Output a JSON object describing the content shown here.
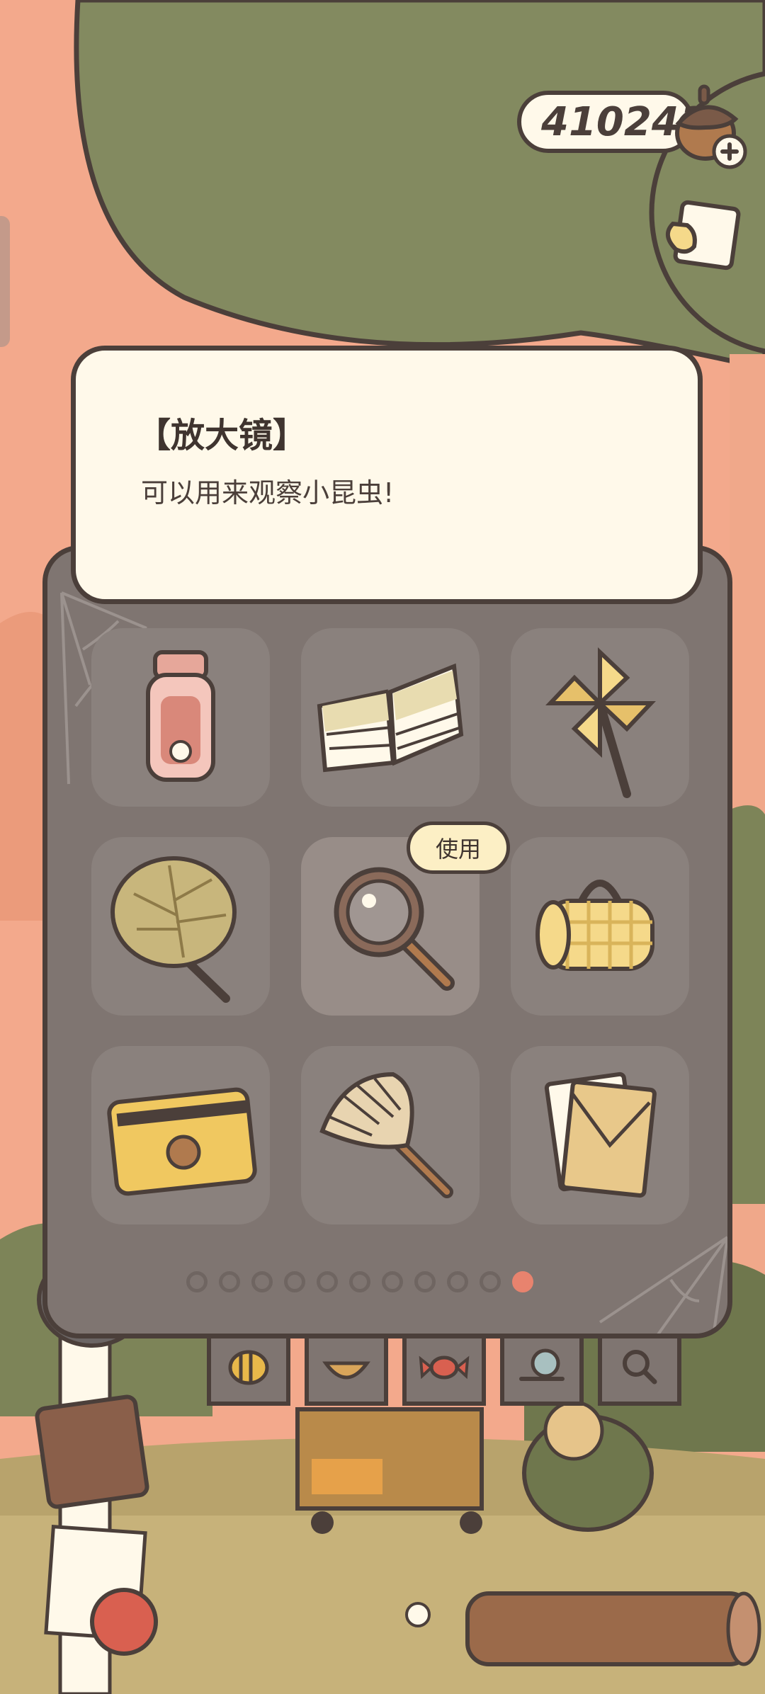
{
  "currency": {
    "amount": "410243",
    "icon": "acorn-icon",
    "plus_icon": "plus-icon"
  },
  "item_detail": {
    "title": "【放大镜】",
    "description": "可以用来观察小昆虫!"
  },
  "inventory": {
    "items": [
      {
        "icon": "jar-icon"
      },
      {
        "icon": "book-icon"
      },
      {
        "icon": "pinwheel-icon"
      },
      {
        "icon": "leaf-fan-icon"
      },
      {
        "icon": "magnifying-glass-icon",
        "selected": true
      },
      {
        "icon": "picnic-mat-icon"
      },
      {
        "icon": "card-icon"
      },
      {
        "icon": "feather-duster-icon"
      },
      {
        "icon": "letter-icon"
      }
    ],
    "use_label": "使用",
    "page_count": 11,
    "current_page": 11
  },
  "category_tabs": [
    {
      "icon": "bee-icon"
    },
    {
      "icon": "bowl-icon"
    },
    {
      "icon": "candy-icon"
    },
    {
      "icon": "snail-icon"
    },
    {
      "icon": "search-icon"
    }
  ],
  "colors": {
    "outline": "#4b3f3a",
    "card": "#fff9ea",
    "panel": "#7f7571",
    "tree": "#838a60",
    "sky": "#f3a98c",
    "accent": "#e8836e"
  }
}
